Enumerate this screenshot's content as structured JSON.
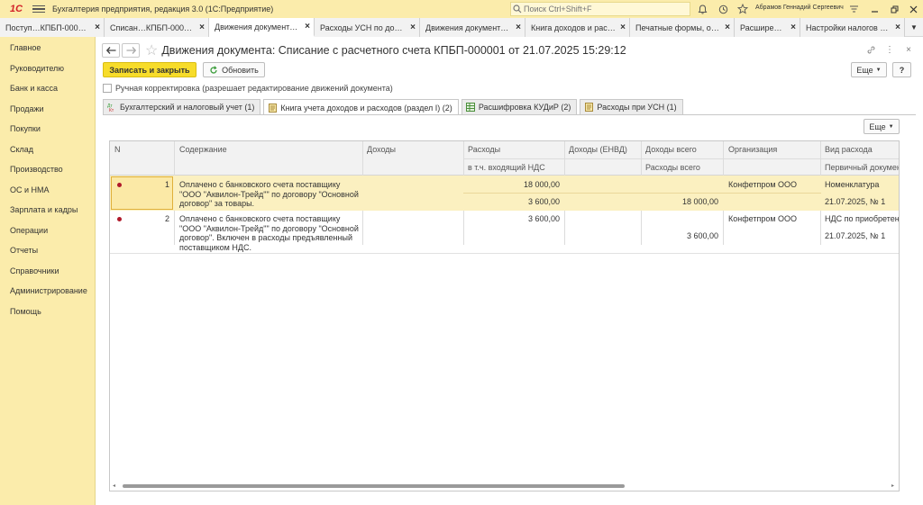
{
  "app": {
    "logo": "1С",
    "title": "Бухгалтерия предприятия, редакция 3.0  (1С:Предприятие)",
    "search_placeholder": "Поиск Ctrl+Shift+F",
    "user": "Абрамов Геннадий Сергеевич"
  },
  "tabs": [
    {
      "label": "Поступ…КПБП-000001"
    },
    {
      "label": "Списан…КПБП-000001"
    },
    {
      "label": "Движения документ…"
    },
    {
      "label": "Расходы УСН по док…"
    },
    {
      "label": "Движения документ…"
    },
    {
      "label": "Книга доходов и рас…"
    },
    {
      "label": "Печатные формы, о…"
    },
    {
      "label": "Расширения"
    },
    {
      "label": "Настройки налогов и…"
    }
  ],
  "sidebar": {
    "items": [
      {
        "label": "Главное"
      },
      {
        "label": "Руководителю"
      },
      {
        "label": "Банк и касса"
      },
      {
        "label": "Продажи"
      },
      {
        "label": "Покупки"
      },
      {
        "label": "Склад"
      },
      {
        "label": "Производство"
      },
      {
        "label": "ОС и НМА"
      },
      {
        "label": "Зарплата и кадры"
      },
      {
        "label": "Операции"
      },
      {
        "label": "Отчеты"
      },
      {
        "label": "Справочники"
      },
      {
        "label": "Администрирование"
      },
      {
        "label": "Помощь"
      }
    ]
  },
  "document": {
    "title": "Движения документа: Списание с расчетного счета КПБП-000001 от 21.07.2025 15:29:12",
    "save_close": "Записать и закрыть",
    "refresh": "Обновить",
    "more": "Еще",
    "help": "?",
    "manual_correction": "Ручная корректировка (разрешает редактирование движений документа)"
  },
  "subtabs": [
    {
      "label": "Бухгалтерский и налоговый учет (1)"
    },
    {
      "label": "Книга учета доходов и расходов (раздел I) (2)"
    },
    {
      "label": "Расшифровка КУДиР (2)"
    },
    {
      "label": "Расходы при УСН (1)"
    }
  ],
  "table": {
    "more": "Еще",
    "headers": {
      "n": "N",
      "content": "Содержание",
      "income": "Доходы",
      "expense": "Расходы",
      "expense_vat": "в т.ч. входящий НДС",
      "income_envd": "Доходы (ЕНВД)",
      "income_total": "Доходы всего",
      "expense_total": "Расходы всего",
      "org": "Организация",
      "exp_type": "Вид расхода",
      "primary_doc": "Первичный докумен"
    },
    "rows": [
      {
        "n": "1",
        "content": "Оплачено с банковского счета поставщику \"ООО \"Аквилон-Трейд\"\" по договору \"Основной договор\" за товары.",
        "expense": "18 000,00",
        "expense_vat": "3 600,00",
        "expense_total": "18 000,00",
        "org": "Конфетпром ООО",
        "exp_type": "Номенклатура",
        "primary_doc": "21.07.2025, № 1"
      },
      {
        "n": "2",
        "content": "Оплачено с банковского счета поставщику \"ООО \"Аквилон-Трейд\"\" по договору \"Основной договор\". Включен в расходы предъявленный поставщиком НДС.",
        "expense": "3 600,00",
        "expense_total": "3 600,00",
        "org": "Конфетпром ООО",
        "exp_type": "НДС по приобретен",
        "primary_doc": "21.07.2025, № 1"
      }
    ]
  }
}
